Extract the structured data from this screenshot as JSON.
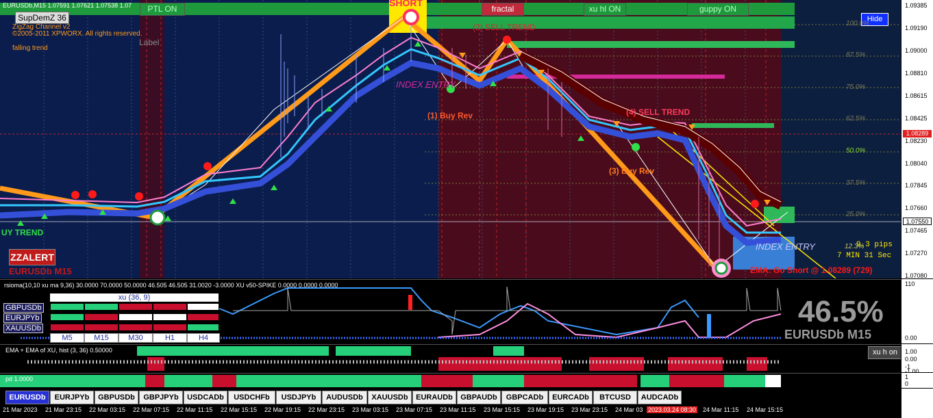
{
  "header": {
    "symbol_line": "EURUSDb,M15  1.07591 1.07621 1.07538 1.07",
    "supdem": "SupDemZ 36",
    "zigzag": "ZigZag Channel v2",
    "copyright": "©2005-2011 XPWORX. All rights reserved.",
    "label": "Label",
    "falling": "falling trend"
  },
  "top_buttons": {
    "ptl": "PTL ON",
    "fractal": "fractal",
    "xuhl": "xu hl ON",
    "guppy": "guppy ON",
    "hide": "Hide"
  },
  "annotations": {
    "short": "SHORT",
    "sell2": "(2) SELL TREND",
    "buy1": "(1) Buy Rev",
    "sell4": "(4) SELL TREND",
    "buy3": "(3) Buy Rev",
    "index_entry_top": "INDEX ENTRY",
    "index_entry_bottom": "INDEX ENTRY",
    "buy_trend": "UY TREND",
    "zzalert": "ZZALERT",
    "chart_name": "EURUSDb M15",
    "pips": "9.3 pips",
    "timer": "7 MIN 31 Sec",
    "ema": "EMA: Go Short @ 1.08289 (729)",
    "pct_small": "12.3%"
  },
  "fib_levels": [
    "100.0%",
    "87.5%",
    "75.0%",
    "62.5%",
    "50.0%",
    "37.5%",
    "25.0%"
  ],
  "price_axis": {
    "ticks": [
      "1.09385",
      "1.09190",
      "1.09000",
      "1.08810",
      "1.08615",
      "1.08425",
      "1.08230",
      "1.08040",
      "1.07845",
      "1.07660",
      "1.07465",
      "1.07270",
      "1.07080"
    ],
    "red_label": "1.08289",
    "current": "1.07550"
  },
  "rsioma": {
    "header": "rsioma(10,10 xu ma 9,36) 30.0000 70.0000 50.0000 46.505 46.505 31.0020 -3.0000  XU v50-SPIKE 0.0000 0.0000 0.0000",
    "grid_title": "xu (36, 9)",
    "symbols": [
      "GBPUSDb",
      "EURJPYb",
      "XAUUSDb"
    ],
    "timeframes": [
      "M5",
      "M15",
      "M30",
      "H1",
      "H4"
    ],
    "cells": [
      [
        "green",
        "green",
        "red",
        "red",
        "white"
      ],
      [
        "green",
        "red",
        "white",
        "white",
        "red"
      ],
      [
        "red",
        "red",
        "red",
        "red",
        "green"
      ]
    ],
    "big_pct": "46.5%",
    "big_symbol": "EURUSDb M15",
    "axis": [
      "110",
      "0.00"
    ]
  },
  "ema_pane": {
    "header": "EMA + EMA of XU, hist (3, 36) 0.50000",
    "button": "xu h on",
    "axis": [
      "1.00",
      "0.00",
      "-1",
      "-1.00"
    ]
  },
  "pd_pane": {
    "header": "pd 1.0000",
    "axis": [
      "1",
      "0"
    ]
  },
  "tabs": [
    "EURUSDb",
    "EURJPYb",
    "GBPUSDb",
    "GBPJPYb",
    "USDCADb",
    "USDCHFb",
    "USDJPYb",
    "AUDUSDb",
    "XAUUSDb",
    "EURAUDb",
    "GBPAUDb",
    "GBPCADb",
    "EURCADb",
    "BTCUSD",
    "AUDCADb"
  ],
  "time_axis": [
    "21 Mar 2023",
    "21 Mar 23:15",
    "22 Mar 03:15",
    "22 Mar 07:15",
    "22 Mar 11:15",
    "22 Mar 15:15",
    "22 Mar 19:15",
    "22 Mar 23:15",
    "23 Mar 03:15",
    "23 Mar 07:15",
    "23 Mar 11:15",
    "23 Mar 15:15",
    "23 Mar 19:15",
    "23 Mar 23:15",
    "24 Mar 03",
    "2023.03.24 08:30",
    "24 Mar 11:15",
    "24 Mar 15:15"
  ],
  "colors": {
    "bg": "#0b1d4d",
    "zone": "#4a0c1c",
    "green": "#1e9a3d",
    "orange": "#ff9a1a",
    "cyan": "#33c8ff",
    "blue_band": "#3550d8",
    "magenta": "#d42a9a",
    "dark_red": "#5a0000"
  }
}
